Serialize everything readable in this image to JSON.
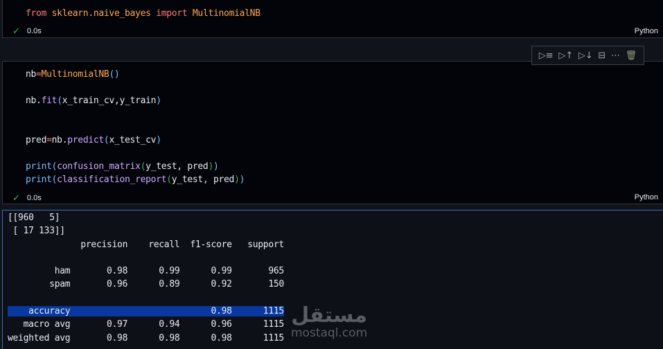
{
  "cells": [
    {
      "code": {
        "kw1": "from",
        "module": "sklearn.naive_bayes",
        "kw2": "import",
        "name": "MultinomialNB"
      },
      "status": "0.0s",
      "language": "Python"
    },
    {
      "lines": [
        "nb=MultinomialNB()",
        "",
        "nb.fit(x_train_cv,y_train)",
        "",
        "",
        "pred=nb.predict(x_test_cv)",
        "",
        "print(confusion_matrix(y_test, pred))",
        "print(classification_report(y_test, pred))"
      ],
      "status": "0.0s",
      "language": "Python"
    }
  ],
  "toolbar": {
    "items": [
      "run-by-line-icon",
      "execute-above-icon",
      "execute-below-icon",
      "split-cell-icon",
      "more-icon",
      "delete-icon"
    ]
  },
  "output": {
    "confusion": [
      "[[960   5]",
      " [ 17 133]]"
    ],
    "header": "              precision    recall  f1-score   support",
    "rows": [
      "         ham       0.98      0.99      0.99       965",
      "        spam       0.96      0.89      0.92       150"
    ],
    "accuracy": "    accuracy                           0.98      1115",
    "avg": [
      "   macro avg       0.97      0.94      0.96      1115",
      "weighted avg       0.98      0.98      0.98      1115"
    ]
  },
  "watermark": {
    "arabic": "مستقل",
    "latin": "mostaql.com"
  }
}
